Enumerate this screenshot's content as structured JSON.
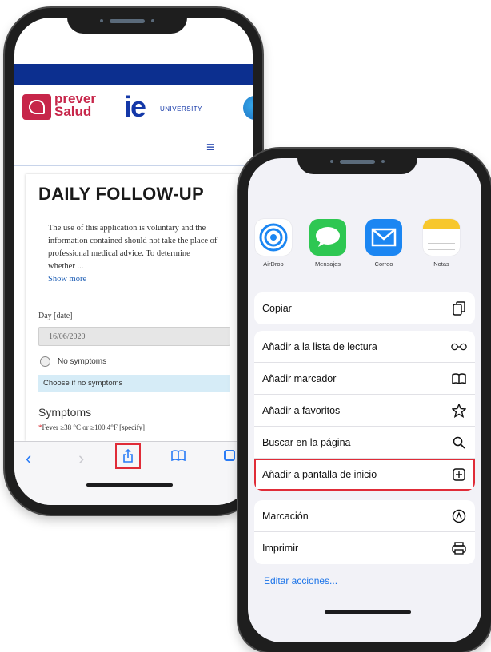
{
  "left_phone": {
    "logos": {
      "prever_line1": "prever",
      "prever_line2": "Salud",
      "ie": "ie",
      "ie_university": "UNIVERSITY"
    },
    "menu_icon": "hamburger-icon",
    "form": {
      "title": "DAILY FOLLOW-UP",
      "notice": "The use of this application is voluntary and the information contained should not take the place of professional medical advice. To determine whether ...",
      "show_more": "Show more",
      "day_label": "Day [date]",
      "day_value": "16/06/2020",
      "no_symptoms_label": "No symptoms",
      "no_symptoms_hint": "Choose if no symptoms",
      "symptoms_heading": "Symptoms",
      "required_mark": "*",
      "fever_label": "Fever ≥38 °C or ≥100.4°F [specify]"
    },
    "toolbar": {
      "back_icon": "chevron-left-icon",
      "forward_icon": "chevron-right-icon",
      "share_icon": "share-icon",
      "bookmarks_icon": "book-icon",
      "tabs_icon": "tabs-icon"
    }
  },
  "right_phone": {
    "share_apps": [
      {
        "label": "AirDrop",
        "icon": "airdrop-icon"
      },
      {
        "label": "Mensajes",
        "icon": "messages-icon"
      },
      {
        "label": "Correo",
        "icon": "mail-icon"
      },
      {
        "label": "Notas",
        "icon": "notes-icon"
      }
    ],
    "actions": {
      "copy": "Copiar",
      "reading_list": "Añadir a la lista de lectura",
      "bookmark": "Añadir marcador",
      "favorites": "Añadir a favoritos",
      "find": "Buscar en la página",
      "home_screen": "Añadir a pantalla de inicio",
      "markup": "Marcación",
      "print": "Imprimir"
    },
    "edit_actions": "Editar acciones..."
  },
  "colors": {
    "brand_blue": "#0c2f8f",
    "prever_red": "#c7264a",
    "ios_blue": "#2a7cf6",
    "highlight_red": "#e02c38"
  }
}
